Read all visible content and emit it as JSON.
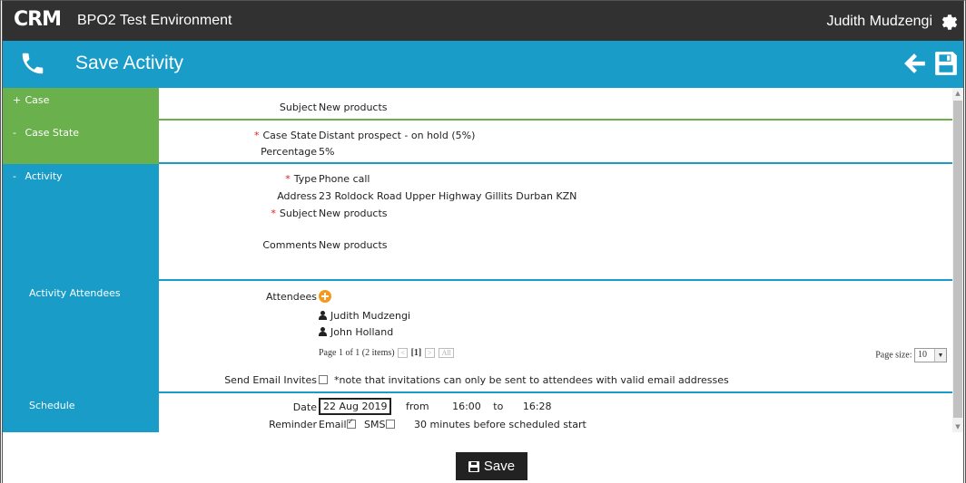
{
  "header": {
    "logo": "CRM",
    "app_title": "BPO2 Test Environment",
    "user_name": "Judith Mudzengi"
  },
  "titlebar": {
    "title": "Save Activity"
  },
  "sections": {
    "case": {
      "toggle": "+",
      "label": "Case",
      "subject_label": "Subject",
      "subject_value": "New products"
    },
    "case_state": {
      "toggle": "-",
      "label": "Case State",
      "state_label": "Case State",
      "state_value": "Distant prospect - on hold (5%)",
      "percentage_label": "Percentage",
      "percentage_value": "5%"
    },
    "activity": {
      "toggle": "-",
      "label": "Activity",
      "type_label": "Type",
      "type_value": "Phone call",
      "address_label": "Address",
      "address_value": "23 Roldock Road Upper Highway Gillits Durban KZN",
      "subject_label": "Subject",
      "subject_value": "New products",
      "comments_label": "Comments",
      "comments_value": "New products"
    },
    "attendees": {
      "label": "Activity Attendees",
      "attendees_label": "Attendees",
      "people": [
        "Judith Mudzengi",
        "John Holland"
      ],
      "pager_text": "Page 1 of 1 (2 items)",
      "current_page": "[1]",
      "all_label": "All",
      "page_size_label": "Page size:",
      "page_size_value": "10",
      "email_invites_label": "Send Email Invites",
      "email_invites_note": "*note that invitations can only be sent to attendees with valid email addresses"
    },
    "schedule": {
      "label": "Schedule",
      "date_label": "Date",
      "date_value": "22 Aug 2019",
      "from_label": "from",
      "from_value": "16:00",
      "to_label": "to",
      "to_value": "16:28",
      "reminder_label": "Reminder",
      "email_label": "Email",
      "email_checked": true,
      "sms_label": "SMS",
      "sms_checked": false,
      "reminder_text": "30 minutes before scheduled start"
    }
  },
  "footer": {
    "save_label": "Save"
  },
  "colors": {
    "topbar": "#313131",
    "accent_blue": "#1a9cc8",
    "accent_green": "#6ab04c",
    "required": "#e02020",
    "add_orange": "#f39a1e"
  },
  "icons": [
    "gear-icon",
    "phone-icon",
    "back-arrow-icon",
    "save-icon",
    "plus-circle-icon",
    "person-icon"
  ]
}
